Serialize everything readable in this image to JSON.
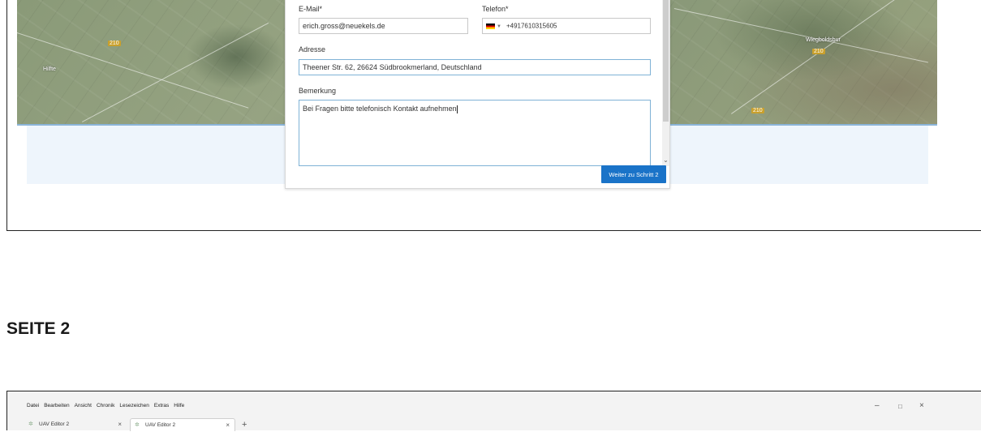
{
  "form": {
    "email_label": "E-Mail*",
    "email_value": "erich.gross@neuekels.de",
    "phone_label": "Telefon*",
    "phone_value": "+4917610315605",
    "phone_country_icon": "flag-de-icon",
    "address_label": "Adresse",
    "address_value": "Theener Str. 62, 26624 Südbrookmerland, Deutschland",
    "remark_label": "Bemerkung",
    "remark_value": "Bei Fragen bitte  telefonisch Kontakt aufnehmen",
    "next_button": "Weiter zu Schritt 2"
  },
  "map": {
    "places": [
      "Hilfte",
      "Wiegboldsbur"
    ],
    "road_tags": [
      "210",
      "210",
      "210"
    ]
  },
  "section_heading": "SEITE 2",
  "browser": {
    "menu": [
      "Datei",
      "Bearbeiten",
      "Ansicht",
      "Chronik",
      "Lesezeichen",
      "Extras",
      "Hilfe"
    ],
    "tabs": [
      {
        "label": "UAV Editor 2",
        "active": false
      },
      {
        "label": "UAV Editor 2",
        "active": true
      }
    ],
    "new_tab": "+",
    "window_controls": {
      "minimize": "–",
      "maximize": "🗗",
      "close": "×"
    }
  }
}
